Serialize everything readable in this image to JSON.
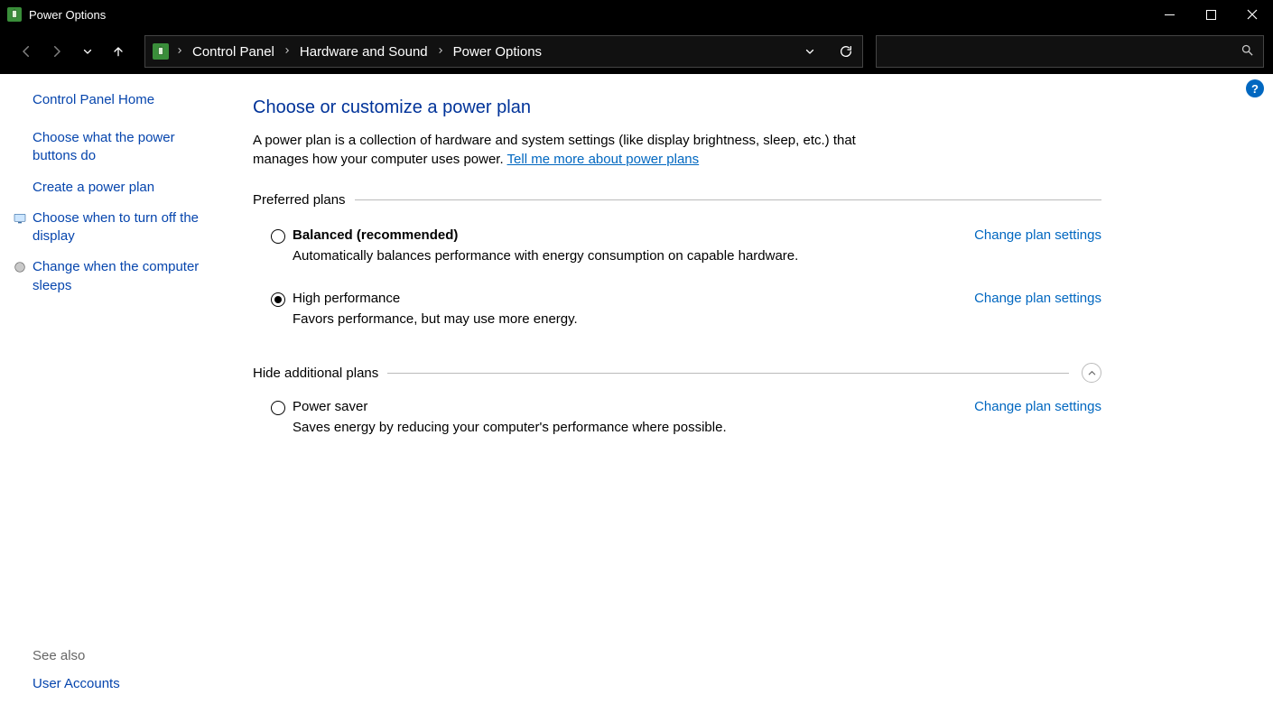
{
  "window": {
    "title": "Power Options"
  },
  "breadcrumbs": {
    "item1": "Control Panel",
    "item2": "Hardware and Sound",
    "item3": "Power Options"
  },
  "sidebar": {
    "home": "Control Panel Home",
    "link1": "Choose what the power buttons do",
    "link2": "Create a power plan",
    "link3": "Choose when to turn off the display",
    "link4": "Change when the computer sleeps",
    "seealso_heading": "See also",
    "seealso_link1": "User Accounts"
  },
  "content": {
    "heading": "Choose or customize a power plan",
    "desc_part1": "A power plan is a collection of hardware and system settings (like display brightness, sleep, etc.) that manages how your computer uses power. ",
    "desc_link": "Tell me more about power plans",
    "section_preferred": "Preferred plans",
    "section_hidden": "Hide additional plans",
    "change_link": "Change plan settings",
    "plans": {
      "balanced": {
        "title": "Balanced (recommended)",
        "desc": "Automatically balances performance with energy consumption on capable hardware."
      },
      "high": {
        "title": "High performance",
        "desc": "Favors performance, but may use more energy."
      },
      "saver": {
        "title": "Power saver",
        "desc": "Saves energy by reducing your computer's performance where possible."
      }
    }
  },
  "help_badge": "?"
}
